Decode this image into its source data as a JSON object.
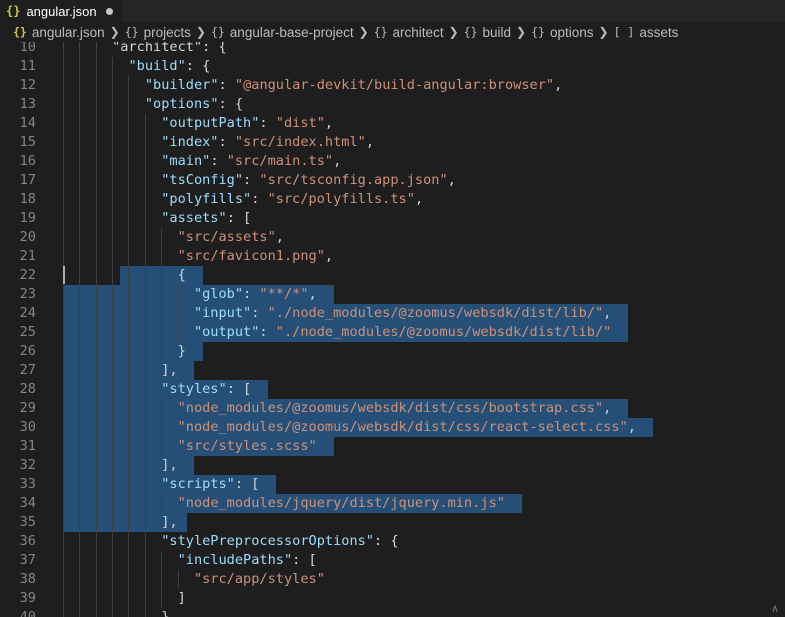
{
  "tab": {
    "icon": "{}",
    "label": "angular.json",
    "modified": true
  },
  "breadcrumbs": [
    {
      "icon": "{}",
      "label": "angular.json"
    },
    {
      "icon": "{}",
      "label": "projects"
    },
    {
      "icon": "{}",
      "label": "angular-base-project"
    },
    {
      "icon": "{}",
      "label": "architect"
    },
    {
      "icon": "{}",
      "label": "build"
    },
    {
      "icon": "{}",
      "label": "options"
    },
    {
      "icon": "[ ]",
      "label": "assets"
    }
  ],
  "lines": [
    {
      "n": "10",
      "tokens": [
        {
          "t": "p",
          "v": "\"architect\": {"
        }
      ]
    },
    {
      "n": "11",
      "tokens": [
        {
          "t": "p",
          "v": "  "
        },
        {
          "t": "k",
          "v": "\"build\""
        },
        {
          "t": "p",
          "v": ": {"
        }
      ]
    },
    {
      "n": "12",
      "tokens": [
        {
          "t": "p",
          "v": "    "
        },
        {
          "t": "k",
          "v": "\"builder\""
        },
        {
          "t": "p",
          "v": ": "
        },
        {
          "t": "s",
          "v": "\"@angular-devkit/build-angular:browser\""
        },
        {
          "t": "p",
          "v": ","
        }
      ]
    },
    {
      "n": "13",
      "tokens": [
        {
          "t": "p",
          "v": "    "
        },
        {
          "t": "k",
          "v": "\"options\""
        },
        {
          "t": "p",
          "v": ": {"
        }
      ]
    },
    {
      "n": "14",
      "tokens": [
        {
          "t": "p",
          "v": "      "
        },
        {
          "t": "k",
          "v": "\"outputPath\""
        },
        {
          "t": "p",
          "v": ": "
        },
        {
          "t": "s",
          "v": "\"dist\""
        },
        {
          "t": "p",
          "v": ","
        }
      ]
    },
    {
      "n": "15",
      "tokens": [
        {
          "t": "p",
          "v": "      "
        },
        {
          "t": "k",
          "v": "\"index\""
        },
        {
          "t": "p",
          "v": ": "
        },
        {
          "t": "s",
          "v": "\"src/index.html\""
        },
        {
          "t": "p",
          "v": ","
        }
      ]
    },
    {
      "n": "16",
      "tokens": [
        {
          "t": "p",
          "v": "      "
        },
        {
          "t": "k",
          "v": "\"main\""
        },
        {
          "t": "p",
          "v": ": "
        },
        {
          "t": "s",
          "v": "\"src/main.ts\""
        },
        {
          "t": "p",
          "v": ","
        }
      ]
    },
    {
      "n": "17",
      "tokens": [
        {
          "t": "p",
          "v": "      "
        },
        {
          "t": "k",
          "v": "\"tsConfig\""
        },
        {
          "t": "p",
          "v": ": "
        },
        {
          "t": "s",
          "v": "\"src/tsconfig.app.json\""
        },
        {
          "t": "p",
          "v": ","
        }
      ]
    },
    {
      "n": "18",
      "tokens": [
        {
          "t": "p",
          "v": "      "
        },
        {
          "t": "k",
          "v": "\"polyfills\""
        },
        {
          "t": "p",
          "v": ": "
        },
        {
          "t": "s",
          "v": "\"src/polyfills.ts\""
        },
        {
          "t": "p",
          "v": ","
        }
      ]
    },
    {
      "n": "19",
      "tokens": [
        {
          "t": "p",
          "v": "      "
        },
        {
          "t": "k",
          "v": "\"assets\""
        },
        {
          "t": "p",
          "v": ": ["
        }
      ]
    },
    {
      "n": "20",
      "tokens": [
        {
          "t": "p",
          "v": "        "
        },
        {
          "t": "s",
          "v": "\"src/assets\""
        },
        {
          "t": "p",
          "v": ","
        }
      ]
    },
    {
      "n": "21",
      "tokens": [
        {
          "t": "p",
          "v": "        "
        },
        {
          "t": "s",
          "v": "\"src/favicon1.png\""
        },
        {
          "t": "p",
          "v": ","
        }
      ]
    },
    {
      "n": "22",
      "tokens": [
        {
          "t": "p",
          "v": "        {"
        }
      ]
    },
    {
      "n": "23",
      "tokens": [
        {
          "t": "p",
          "v": "          "
        },
        {
          "t": "k",
          "v": "\"glob\""
        },
        {
          "t": "p",
          "v": ": "
        },
        {
          "t": "s",
          "v": "\"**/*\""
        },
        {
          "t": "p",
          "v": ","
        }
      ]
    },
    {
      "n": "24",
      "tokens": [
        {
          "t": "p",
          "v": "          "
        },
        {
          "t": "k",
          "v": "\"input\""
        },
        {
          "t": "p",
          "v": ": "
        },
        {
          "t": "s",
          "v": "\"./node_modules/@zoomus/websdk/dist/lib/\""
        },
        {
          "t": "p",
          "v": ","
        }
      ]
    },
    {
      "n": "25",
      "tokens": [
        {
          "t": "p",
          "v": "          "
        },
        {
          "t": "k",
          "v": "\"output\""
        },
        {
          "t": "p",
          "v": ": "
        },
        {
          "t": "s",
          "v": "\"./node_modules/@zoomus/websdk/dist/lib/\""
        }
      ]
    },
    {
      "n": "26",
      "tokens": [
        {
          "t": "p",
          "v": "        }"
        }
      ]
    },
    {
      "n": "27",
      "tokens": [
        {
          "t": "p",
          "v": "      ],"
        }
      ]
    },
    {
      "n": "28",
      "tokens": [
        {
          "t": "p",
          "v": "      "
        },
        {
          "t": "k",
          "v": "\"styles\""
        },
        {
          "t": "p",
          "v": ": ["
        }
      ]
    },
    {
      "n": "29",
      "tokens": [
        {
          "t": "p",
          "v": "        "
        },
        {
          "t": "s",
          "v": "\"node_modules/@zoomus/websdk/dist/css/bootstrap.css\""
        },
        {
          "t": "p",
          "v": ","
        }
      ]
    },
    {
      "n": "30",
      "tokens": [
        {
          "t": "p",
          "v": "        "
        },
        {
          "t": "s",
          "v": "\"node_modules/@zoomus/websdk/dist/css/react-select.css\""
        },
        {
          "t": "p",
          "v": ","
        }
      ]
    },
    {
      "n": "31",
      "tokens": [
        {
          "t": "p",
          "v": "        "
        },
        {
          "t": "s",
          "v": "\"src/styles.scss\""
        }
      ]
    },
    {
      "n": "32",
      "tokens": [
        {
          "t": "p",
          "v": "      ],"
        }
      ]
    },
    {
      "n": "33",
      "tokens": [
        {
          "t": "p",
          "v": "      "
        },
        {
          "t": "k",
          "v": "\"scripts\""
        },
        {
          "t": "p",
          "v": ": ["
        }
      ]
    },
    {
      "n": "34",
      "tokens": [
        {
          "t": "p",
          "v": "        "
        },
        {
          "t": "s",
          "v": "\"node_modules/jquery/dist/jquery.min.js\""
        }
      ]
    },
    {
      "n": "35",
      "tokens": [
        {
          "t": "p",
          "v": "      ],"
        }
      ]
    },
    {
      "n": "36",
      "tokens": [
        {
          "t": "p",
          "v": "      "
        },
        {
          "t": "k",
          "v": "\"stylePreprocessorOptions\""
        },
        {
          "t": "p",
          "v": ": {"
        }
      ]
    },
    {
      "n": "37",
      "tokens": [
        {
          "t": "p",
          "v": "        "
        },
        {
          "t": "k",
          "v": "\"includePaths\""
        },
        {
          "t": "p",
          "v": ": ["
        }
      ]
    },
    {
      "n": "38",
      "tokens": [
        {
          "t": "p",
          "v": "          "
        },
        {
          "t": "s",
          "v": "\"src/app/styles\""
        }
      ]
    },
    {
      "n": "39",
      "tokens": [
        {
          "t": "p",
          "v": "        ]"
        }
      ]
    },
    {
      "n": "40",
      "tokens": [
        {
          "t": "p",
          "v": "      },"
        }
      ]
    }
  ],
  "selection": {
    "from_line": "22",
    "to_line": "35"
  },
  "colors": {
    "background": "#1e1e1e",
    "key": "#9cdcfe",
    "string": "#ce9178",
    "punct": "#d4d4d4",
    "line_number": "#858585",
    "selection": "#264f78",
    "json_icon": "#cbcb41"
  }
}
